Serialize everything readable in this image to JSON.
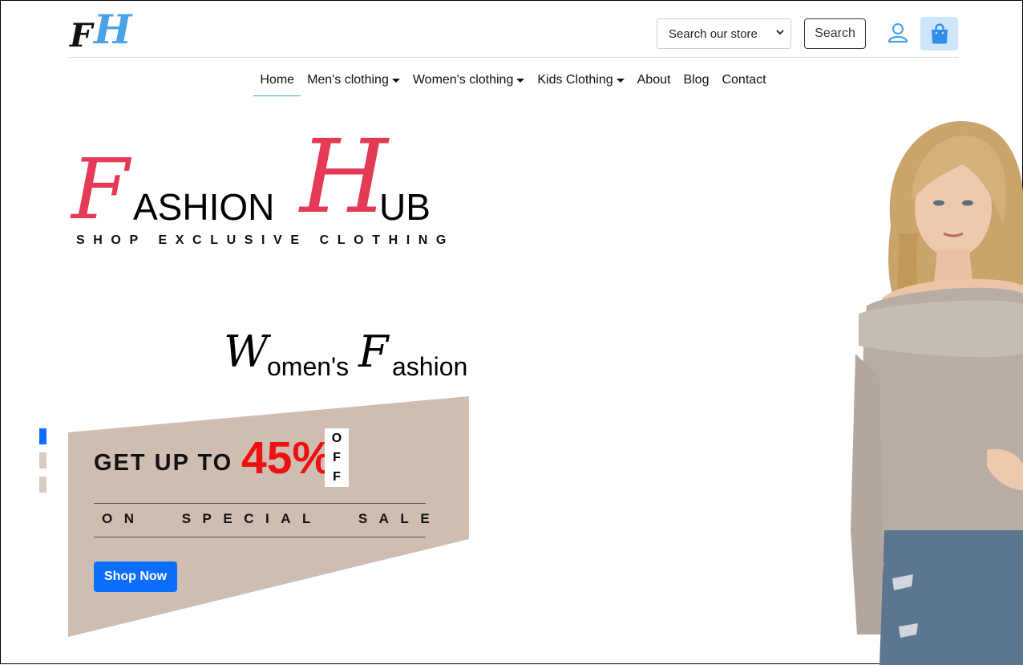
{
  "header": {
    "logo": {
      "letter1": "F",
      "letter2": "H"
    },
    "search_select": {
      "selected": "Search our store"
    },
    "search_button_label": "Search",
    "icons": {
      "account": "user-icon",
      "cart": "shopping-bag-icon"
    }
  },
  "nav": {
    "items": [
      {
        "label": "Home",
        "active": true,
        "dropdown": false
      },
      {
        "label": "Men's clothing",
        "dropdown": true
      },
      {
        "label": "Women's clothing",
        "dropdown": true
      },
      {
        "label": "Kids Clothing",
        "dropdown": true
      },
      {
        "label": "About",
        "dropdown": false
      },
      {
        "label": "Blog",
        "dropdown": false
      },
      {
        "label": "Contact",
        "dropdown": false
      }
    ]
  },
  "hero": {
    "brand": {
      "cap1": "F",
      "word1": "ASHION",
      "cap2": "H",
      "word2": "UB"
    },
    "tagline": "SHOP EXCLUSIVE CLOTHING",
    "category": {
      "cap1": "W",
      "rest1": "omen's",
      "cap2": "F",
      "rest2": "ashion"
    },
    "promo": {
      "get_up_to": "GET UP TO",
      "percent": "45%",
      "off_letters": [
        "O",
        "F",
        "F"
      ],
      "special": "ON SPECIAL SALE",
      "shop_now": "Shop Now"
    },
    "carousel": {
      "slides": 3,
      "active_index": 0
    }
  },
  "colors": {
    "accent_red": "#e53a56",
    "sale_red": "#ee1111",
    "banner_beige": "#cfbdb1",
    "primary_blue": "#0d6efd",
    "logo_blue": "#4aa3e6",
    "cart_bg": "#cfe5fb",
    "indicator_inactive": "#d9cbc1"
  }
}
